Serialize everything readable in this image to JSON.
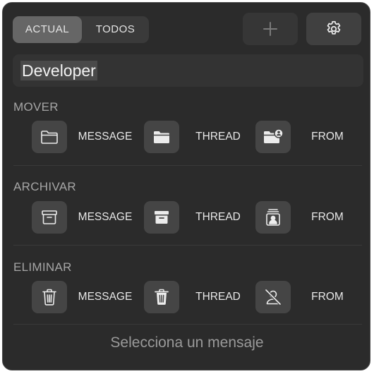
{
  "tabs": {
    "actual": "ACTUAL",
    "todos": "TODOS",
    "selected": "actual"
  },
  "toolbar": {
    "add_icon": "plus-icon",
    "settings_icon": "gear-icon"
  },
  "search": {
    "value": "Developer"
  },
  "sections": {
    "mover": {
      "title": "MOVER",
      "message": "MESSAGE",
      "thread": "THREAD",
      "from": "FROM",
      "icons": [
        "folder-outline-icon",
        "folder-filled-icon",
        "folder-person-icon"
      ]
    },
    "archivar": {
      "title": "ARCHIVAR",
      "message": "MESSAGE",
      "thread": "THREAD",
      "from": "FROM",
      "icons": [
        "archive-outline-icon",
        "archive-filled-icon",
        "contact-card-icon"
      ]
    },
    "eliminar": {
      "title": "ELIMINAR",
      "message": "MESSAGE",
      "thread": "THREAD",
      "from": "FROM",
      "icons": [
        "trash-outline-icon",
        "trash-filled-icon",
        "person-slash-icon"
      ]
    }
  },
  "footer": {
    "status": "Selecciona un mensaje"
  },
  "colors": {
    "panel_bg": "#2b2b2b",
    "button_bg": "#454545",
    "text": "#e8e8e8",
    "muted": "#a6a6a6"
  }
}
